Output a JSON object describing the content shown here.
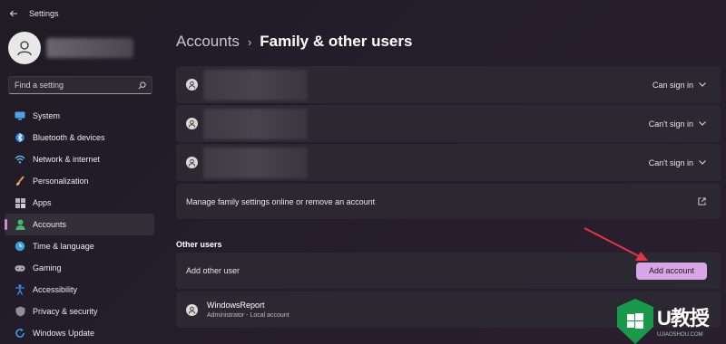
{
  "app": {
    "title": "Settings"
  },
  "sidebar": {
    "search_placeholder": "Find a setting",
    "items": [
      {
        "label": "System",
        "icon": "monitor-icon",
        "active": false
      },
      {
        "label": "Bluetooth & devices",
        "icon": "bluetooth-icon",
        "active": false
      },
      {
        "label": "Network & internet",
        "icon": "wifi-icon",
        "active": false
      },
      {
        "label": "Personalization",
        "icon": "brush-icon",
        "active": false
      },
      {
        "label": "Apps",
        "icon": "apps-icon",
        "active": false
      },
      {
        "label": "Accounts",
        "icon": "person-icon",
        "active": true
      },
      {
        "label": "Time & language",
        "icon": "globe-clock-icon",
        "active": false
      },
      {
        "label": "Gaming",
        "icon": "gamepad-icon",
        "active": false
      },
      {
        "label": "Accessibility",
        "icon": "accessibility-icon",
        "active": false
      },
      {
        "label": "Privacy & security",
        "icon": "shield-icon",
        "active": false
      },
      {
        "label": "Windows Update",
        "icon": "update-icon",
        "active": false
      }
    ]
  },
  "breadcrumb": {
    "parent": "Accounts",
    "separator": "›",
    "current": "Family & other users"
  },
  "family": {
    "members": [
      {
        "status": "Can sign in"
      },
      {
        "status": "Can't sign in"
      },
      {
        "status": "Can't sign in"
      }
    ],
    "manage_label": "Manage family settings online or remove an account"
  },
  "other_users": {
    "section_title": "Other users",
    "add_label": "Add other user",
    "add_button": "Add account",
    "user": {
      "name": "WindowsReport",
      "subtitle": "Administrator - Local account"
    }
  },
  "watermark": {
    "text": "U教授",
    "url": "UJIAOSHOU.COM"
  },
  "colors": {
    "accent": "#d9a5e6",
    "arrow": "#e8324a",
    "card": "#2c2832",
    "watermark_green": "#19994a"
  }
}
